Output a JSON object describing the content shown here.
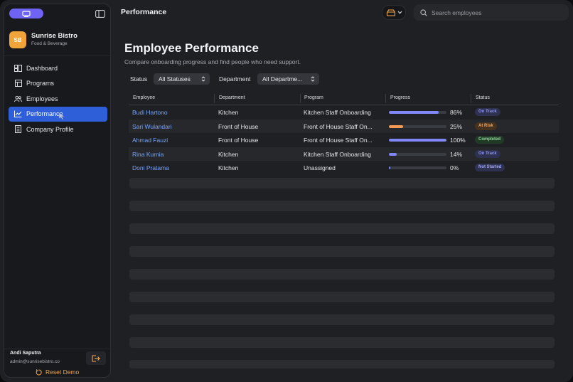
{
  "sidebar": {
    "org": {
      "initials": "SB",
      "name": "Sunrise Bistro",
      "subtitle": "Food & Beverage"
    },
    "nav": [
      {
        "label": "Dashboard",
        "icon": "dashboard-icon"
      },
      {
        "label": "Programs",
        "icon": "programs-icon"
      },
      {
        "label": "Employees",
        "icon": "employees-icon"
      },
      {
        "label": "Performance",
        "icon": "chart-icon",
        "active": true
      },
      {
        "label": "Company Profile",
        "icon": "company-icon"
      }
    ],
    "user": {
      "name": "Andi Saputra",
      "email": "admin@sunrisebistro.co"
    },
    "reset_label": "Reset Demo"
  },
  "topbar": {
    "title": "Performance",
    "search_placeholder": "Search employees"
  },
  "page": {
    "title": "Employee Performance",
    "subtitle": "Compare onboarding progress and find people who need support.",
    "filters": {
      "status_label": "Status",
      "status_value": "All Statuses",
      "department_label": "Department",
      "department_value": "All Departme..."
    }
  },
  "table": {
    "headers": [
      "Employee",
      "Department",
      "Program",
      "Progress",
      "Status"
    ],
    "rows": [
      {
        "employee": "Budi Hartono",
        "department": "Kitchen",
        "program": "Kitchen Staff Onboarding",
        "progress": 86,
        "progress_label": "86%",
        "status": "On Track",
        "status_color": "#8e95f0",
        "status_bg": "#2e3150",
        "bar_color": "#7f86f5"
      },
      {
        "employee": "Sari Wulandari",
        "department": "Front of House",
        "program": "Front of House Staff On...",
        "progress": 25,
        "progress_label": "25%",
        "status": "At Risk",
        "status_color": "#f0a766",
        "status_bg": "#45321f",
        "bar_color": "#f09a55"
      },
      {
        "employee": "Ahmad Fauzi",
        "department": "Front of House",
        "program": "Front of House Staff On...",
        "progress": 100,
        "progress_label": "100%",
        "status": "Completed",
        "status_color": "#8fd99c",
        "status_bg": "#213a26",
        "bar_color": "#7f86f5"
      },
      {
        "employee": "Rina Kurnia",
        "department": "Kitchen",
        "program": "Kitchen Staff Onboarding",
        "progress": 14,
        "progress_label": "14%",
        "status": "On Track",
        "status_color": "#8e95f0",
        "status_bg": "#2e3150",
        "bar_color": "#7f86f5"
      },
      {
        "employee": "Doni Pratama",
        "department": "Kitchen",
        "program": "Unassigned",
        "progress": 0,
        "progress_label": "0%",
        "status": "Not Started",
        "status_color": "#9ea6f2",
        "status_bg": "#2e3150",
        "bar_color": "#7f86f5"
      }
    ]
  }
}
